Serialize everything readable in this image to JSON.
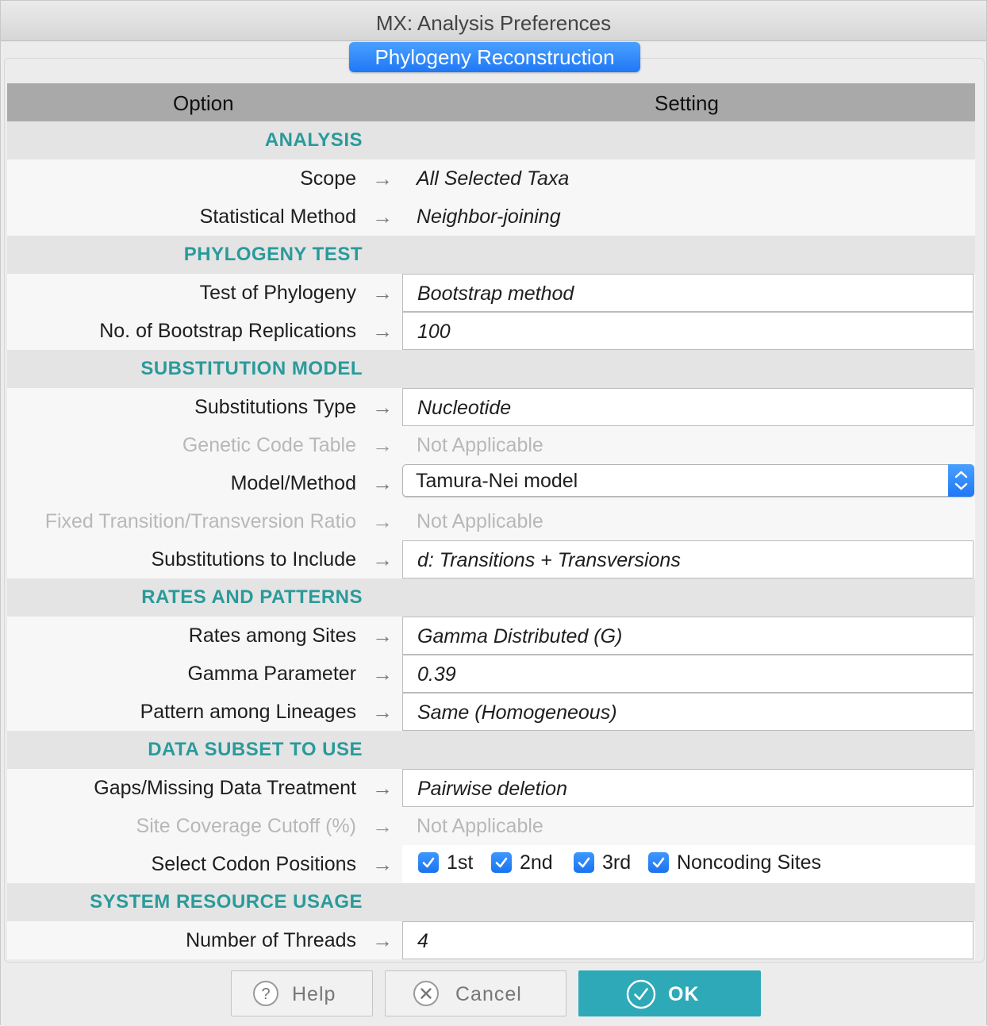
{
  "window": {
    "title": "MX: Analysis Preferences"
  },
  "tab": {
    "label": "Phylogeny Reconstruction"
  },
  "header": {
    "option": "Option",
    "setting": "Setting"
  },
  "sections": {
    "analysis": "ANALYSIS",
    "phylogeny_test": "PHYLOGENY TEST",
    "substitution_model": "SUBSTITUTION MODEL",
    "rates_patterns": "RATES AND PATTERNS",
    "data_subset": "DATA SUBSET TO USE",
    "system_resource": "SYSTEM RESOURCE USAGE"
  },
  "arrow_glyph": "→",
  "rows": {
    "scope": {
      "label": "Scope",
      "value": "All Selected Taxa"
    },
    "stat_method": {
      "label": "Statistical Method",
      "value": "Neighbor-joining"
    },
    "test_phylogeny": {
      "label": "Test of Phylogeny",
      "value": "Bootstrap method"
    },
    "bootstrap_reps": {
      "label": "No. of Bootstrap Replications",
      "value": "100"
    },
    "subst_type": {
      "label": "Substitutions Type",
      "value": "Nucleotide"
    },
    "genetic_code": {
      "label": "Genetic Code Table",
      "value": "Not Applicable"
    },
    "model_method": {
      "label": "Model/Method",
      "value": "Tamura-Nei model"
    },
    "fixed_ratio": {
      "label": "Fixed Transition/Transversion Ratio",
      "value": "Not Applicable"
    },
    "subst_include": {
      "label": "Substitutions to Include",
      "value": "d: Transitions + Transversions"
    },
    "rates_sites": {
      "label": "Rates among Sites",
      "value": "Gamma Distributed (G)"
    },
    "gamma_param": {
      "label": "Gamma Parameter",
      "value": "0.39"
    },
    "pattern_lineages": {
      "label": "Pattern among Lineages",
      "value": "Same (Homogeneous)"
    },
    "gaps_missing": {
      "label": "Gaps/Missing Data Treatment",
      "value": "Pairwise deletion"
    },
    "site_coverage": {
      "label": "Site Coverage Cutoff (%)",
      "value": "Not Applicable"
    },
    "codon_positions": {
      "label": "Select Codon Positions"
    },
    "threads": {
      "label": "Number of Threads",
      "value": "4"
    }
  },
  "codon_checks": {
    "first": {
      "label": "1st",
      "checked": true
    },
    "second": {
      "label": "2nd",
      "checked": true
    },
    "third": {
      "label": "3rd",
      "checked": true
    },
    "noncoding": {
      "label": "Noncoding Sites",
      "checked": true
    }
  },
  "buttons": {
    "help": "Help",
    "cancel": "Cancel",
    "ok": "OK"
  },
  "colors": {
    "accent_blue": "#1f78f5",
    "section_teal": "#2a9a9a",
    "ok_button": "#2ea9b8",
    "disabled_text": "#b8b8b8"
  }
}
